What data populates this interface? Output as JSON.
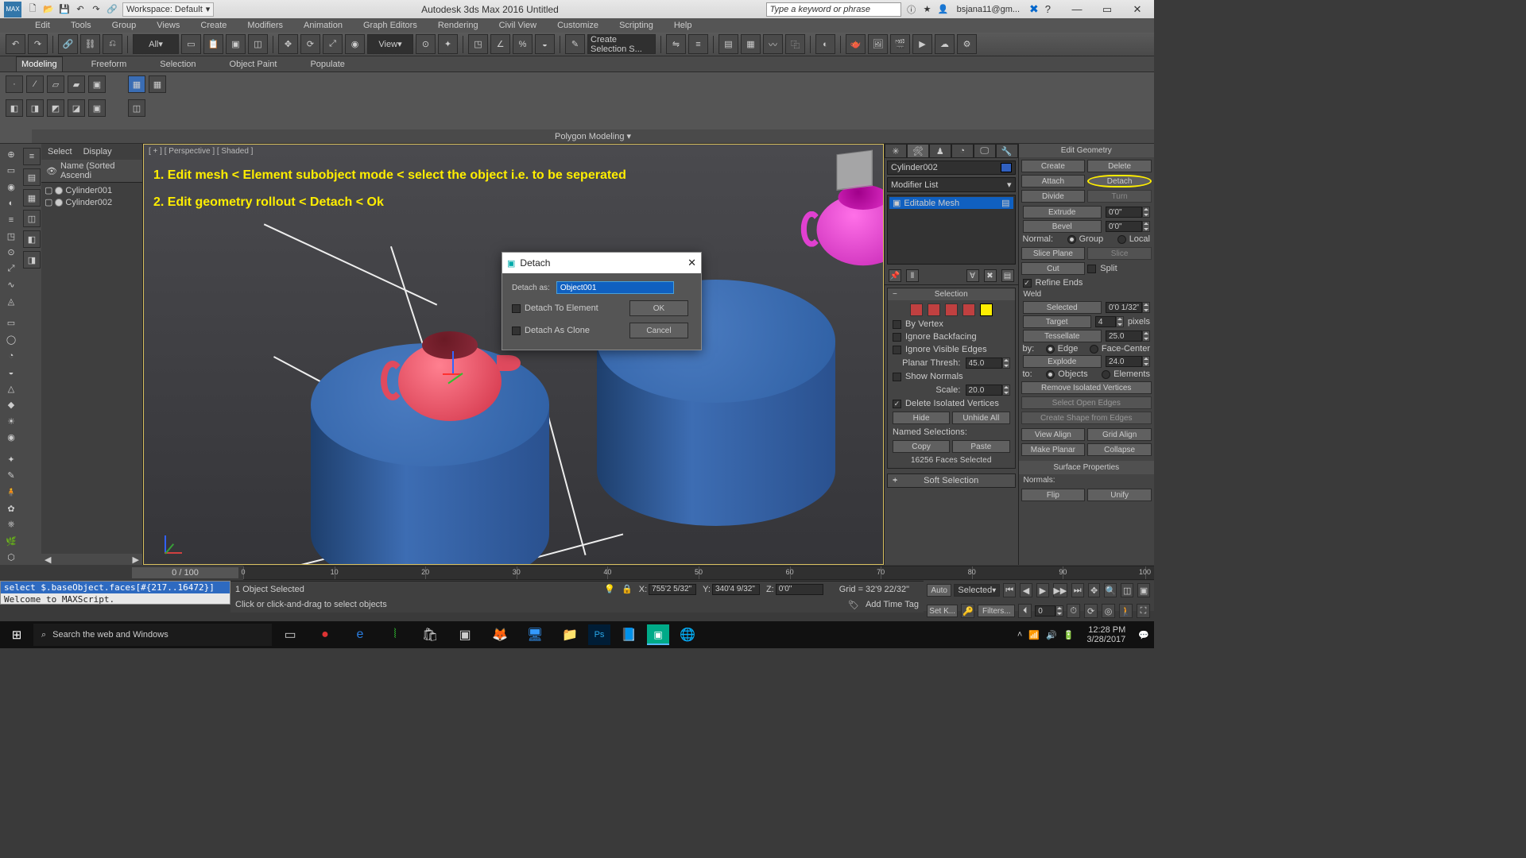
{
  "title": {
    "app": "Autodesk 3ds Max 2016   Untitled",
    "workspace": "Workspace: Default",
    "search_placeholder": "Type a keyword or phrase",
    "user": "bsjana11@gm..."
  },
  "menubar": [
    "Edit",
    "Tools",
    "Group",
    "Views",
    "Create",
    "Modifiers",
    "Animation",
    "Graph Editors",
    "Rendering",
    "Civil View",
    "Customize",
    "Scripting",
    "Help"
  ],
  "maintoolbar": {
    "filter_dd": "All",
    "view_dd": "View",
    "selset_placeholder": "Create Selection S..."
  },
  "ribbon": {
    "tabs": [
      "Modeling",
      "Freeform",
      "Selection",
      "Object Paint",
      "Populate"
    ],
    "active": 0,
    "section": "Polygon Modeling ▾"
  },
  "scene_explorer": {
    "tabs": [
      "Select",
      "Display"
    ],
    "header": "Name (Sorted Ascendi",
    "items": [
      {
        "label": "Cylinder001"
      },
      {
        "label": "Cylinder002"
      }
    ]
  },
  "viewport": {
    "label": "[ + ] [ Perspective ] [ Shaded ]",
    "annot1": "1. Edit mesh  <  Element subobject mode  < select the object i.e. to be seperated",
    "annot2": "2. Edit geometry rollout < Detach < Ok"
  },
  "detach_dialog": {
    "title": "Detach",
    "label": "Detach as:",
    "value": "Object001",
    "opt1": "Detach To Element",
    "opt2": "Detach As Clone",
    "ok": "OK",
    "cancel": "Cancel"
  },
  "command_panel": {
    "object_name": "Cylinder002",
    "modifier_dd": "Modifier List",
    "stack_item": "Editable Mesh",
    "selection": {
      "title": "Selection",
      "by_vertex": "By Vertex",
      "ignore_bf": "Ignore Backfacing",
      "ignore_ve": "Ignore Visible Edges",
      "planar_label": "Planar Thresh:",
      "planar_val": "45.0",
      "show_normals": "Show Normals",
      "scale_label": "Scale:",
      "scale_val": "20.0",
      "del_iso": "Delete Isolated Vertices",
      "hide": "Hide",
      "unhide": "Unhide All",
      "named": "Named Selections:",
      "copy": "Copy",
      "paste": "Paste",
      "faces_sel": "16256 Faces Selected"
    },
    "soft_sel": "Soft Selection"
  },
  "edit_geometry": {
    "title": "Edit Geometry",
    "create": "Create",
    "delete": "Delete",
    "attach": "Attach",
    "detach": "Detach",
    "divide": "Divide",
    "turn": "Turn",
    "extrude": "Extrude",
    "extrude_val": "0'0\"",
    "bevel": "Bevel",
    "bevel_val": "0'0\"",
    "normal": "Normal:",
    "group": "Group",
    "local": "Local",
    "slice_plane": "Slice Plane",
    "slice": "Slice",
    "cut": "Cut",
    "split": "Split",
    "refine": "Refine Ends",
    "weld": "Weld",
    "selected": "Selected",
    "selected_val": "0'0 1/32\"",
    "target": "Target",
    "target_val": "4",
    "pixels": "pixels",
    "tessellate": "Tessellate",
    "tess_val": "25.0",
    "by": "by:",
    "edge": "Edge",
    "facecenter": "Face-Center",
    "explode": "Explode",
    "explode_val": "24.0",
    "to": "to:",
    "objects": "Objects",
    "elements": "Elements",
    "removeiso": "Remove Isolated Vertices",
    "selopen": "Select Open Edges",
    "shape": "Create Shape from Edges",
    "viewalign": "View Align",
    "gridalign": "Grid Align",
    "planar": "Make Planar",
    "collapse": "Collapse",
    "surf_title": "Surface Properties",
    "normals": "Normals:",
    "flip": "Flip",
    "unify": "Unify"
  },
  "timeline": {
    "slider": "0 / 100",
    "ticks": [
      0,
      10,
      20,
      30,
      40,
      50,
      60,
      70,
      80,
      90,
      100
    ]
  },
  "macro": {
    "line1": "select $.baseObject.faces[#{217..16472}]",
    "line2": "Welcome to MAXScript."
  },
  "status": {
    "objects": "1 Object Selected",
    "hint": "Click or click-and-drag to select objects",
    "x_label": "X:",
    "x": "755'2 5/32\"",
    "y_label": "Y:",
    "y": "340'4 9/32\"",
    "z_label": "Z:",
    "z": "0'0\"",
    "grid": "Grid = 32'9 22/32\"",
    "auto": "Auto",
    "setk": "Set K...",
    "selected_dd": "Selected",
    "filters": "Filters...",
    "addtag": "Add Time Tag"
  },
  "taskbar": {
    "search": "Search the web and Windows",
    "time": "12:28 PM",
    "date": "3/28/2017"
  }
}
